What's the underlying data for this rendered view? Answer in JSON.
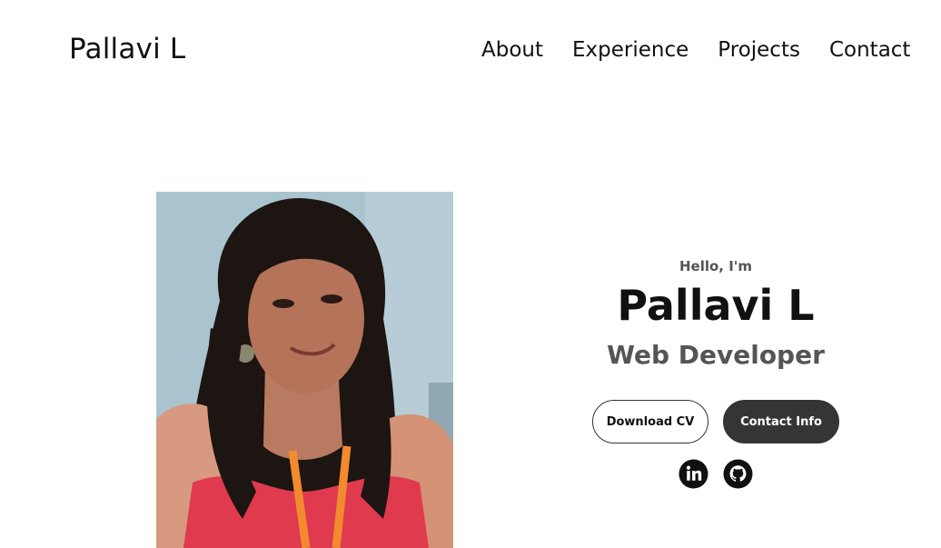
{
  "header": {
    "logo_text": "Pallavi L",
    "nav": [
      {
        "label": "About"
      },
      {
        "label": "Experience"
      },
      {
        "label": "Projects"
      },
      {
        "label": "Contact"
      }
    ]
  },
  "hero": {
    "greeting": "Hello, I'm",
    "name": "Pallavi L",
    "title": "Web Developer",
    "buttons": {
      "download_cv": "Download CV",
      "contact_info": "Contact Info"
    },
    "socials": [
      {
        "icon": "linkedin-icon"
      },
      {
        "icon": "github-icon"
      }
    ]
  },
  "colors": {
    "text_dark": "#111111",
    "text_muted": "#555555",
    "button_dark": "#353535"
  }
}
